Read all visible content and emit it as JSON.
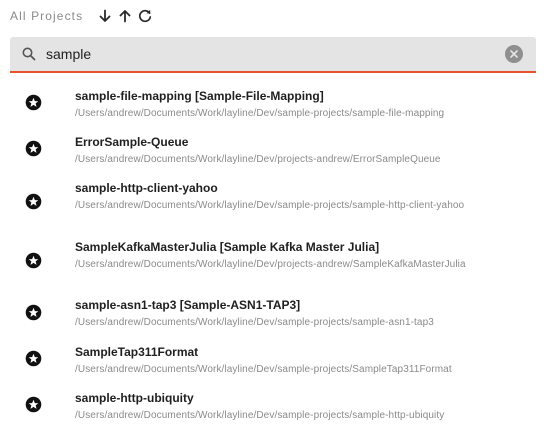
{
  "header": {
    "title": "All Projects",
    "sort_desc_icon": "arrow-down-icon",
    "sort_asc_icon": "arrow-up-icon",
    "refresh_icon": "refresh-icon"
  },
  "search": {
    "value": "sample",
    "icon": "search-icon",
    "clear_icon": "clear-icon"
  },
  "colors": {
    "accent": "#e5522d",
    "search_bg": "#e4e4e4",
    "secondary_text": "#8a8a8a"
  },
  "projects": [
    {
      "title": "sample-file-mapping [Sample-File-Mapping]",
      "path": "/Users/andrew/Documents/Work/layline/Dev/sample-projects/sample-file-mapping",
      "icon": "star-circle-icon"
    },
    {
      "title": "ErrorSample-Queue",
      "path": "/Users/andrew/Documents/Work/layline/Dev/projects-andrew/ErrorSampleQueue",
      "icon": "star-circle-icon"
    },
    {
      "title": "sample-http-client-yahoo",
      "path": "/Users/andrew/Documents/Work/layline/Dev/sample-projects/sample-http-client-yahoo",
      "icon": "star-circle-icon"
    },
    {
      "title": "SampleKafkaMasterJulia [Sample Kafka Master Julia]",
      "path": "/Users/andrew/Documents/Work/layline/Dev/projects-andrew/SampleKafkaMasterJulia",
      "icon": "star-circle-icon"
    },
    {
      "title": "sample-asn1-tap3 [Sample-ASN1-TAP3]",
      "path": "/Users/andrew/Documents/Work/layline/Dev/sample-projects/sample-asn1-tap3",
      "icon": "star-circle-icon"
    },
    {
      "title": "SampleTap311Format",
      "path": "/Users/andrew/Documents/Work/layline/Dev/sample-projects/SampleTap311Format",
      "icon": "star-circle-icon"
    },
    {
      "title": "sample-http-ubiquity",
      "path": "/Users/andrew/Documents/Work/layline/Dev/sample-projects/sample-http-ubiquity",
      "icon": "star-circle-icon"
    }
  ]
}
